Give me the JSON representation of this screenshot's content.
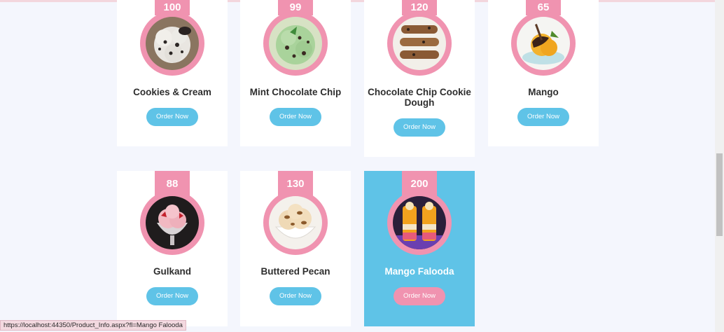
{
  "products": [
    {
      "name": "Cookies & Cream",
      "price": "100",
      "button": "Order Now",
      "image": "cookies-and-cream-scoop",
      "highlighted": false
    },
    {
      "name": "Mint Chocolate Chip",
      "price": "99",
      "button": "Order Now",
      "image": "mint-chocolate-chip-scoop",
      "highlighted": false
    },
    {
      "name": "Chocolate Chip Cookie Dough",
      "price": "120",
      "button": "Order Now",
      "image": "cookie-dough-sandwich-stack",
      "highlighted": false
    },
    {
      "name": "Mango",
      "price": "65",
      "button": "Order Now",
      "image": "mango-scoop-dessert",
      "highlighted": false
    },
    {
      "name": "Gulkand",
      "price": "88",
      "button": "Order Now",
      "image": "gulkand-sundae-glass",
      "highlighted": false
    },
    {
      "name": "Buttered Pecan",
      "price": "130",
      "button": "Order Now",
      "image": "buttered-pecan-bowl",
      "highlighted": false
    },
    {
      "name": "Mango Falooda",
      "price": "200",
      "button": "Order Now",
      "image": "mango-falooda-glasses",
      "highlighted": true
    }
  ],
  "status_bar": {
    "url": "https://localhost:44350/Product_Info.aspx?fl=Mango Falooda"
  },
  "colors": {
    "accent_pink": "#f093b0",
    "accent_blue": "#5fc3e7",
    "page_bg": "#f4f6fd"
  }
}
